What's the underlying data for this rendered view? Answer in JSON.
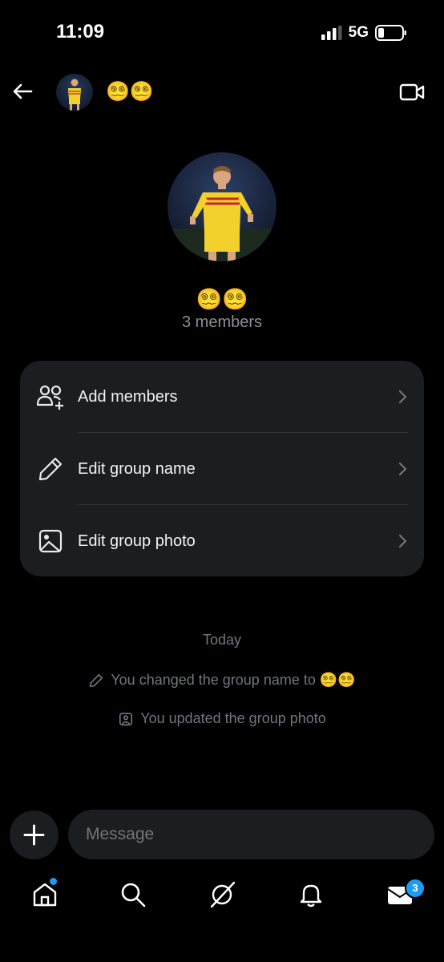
{
  "status": {
    "time": "11:09",
    "network": "5G"
  },
  "header": {
    "title": "😵‍💫😵‍💫"
  },
  "group": {
    "name": "😵‍💫😵‍💫",
    "members": "3 members"
  },
  "menu": [
    {
      "label": "Add members",
      "icon": "add-people-icon"
    },
    {
      "label": "Edit group name",
      "icon": "pencil-icon"
    },
    {
      "label": "Edit group photo",
      "icon": "photo-icon"
    }
  ],
  "timeline": {
    "day": "Today",
    "events": [
      {
        "text": "You changed the group name to 😵‍💫😵‍💫",
        "icon": "pencil-icon"
      },
      {
        "text": "You updated the group photo",
        "icon": "photo-icon"
      }
    ]
  },
  "composer": {
    "placeholder": "Message"
  },
  "nav": {
    "badge": "3"
  },
  "colors": {
    "accent": "#1d9bf0",
    "card": "#1c1d1f",
    "muted": "#71767b"
  }
}
